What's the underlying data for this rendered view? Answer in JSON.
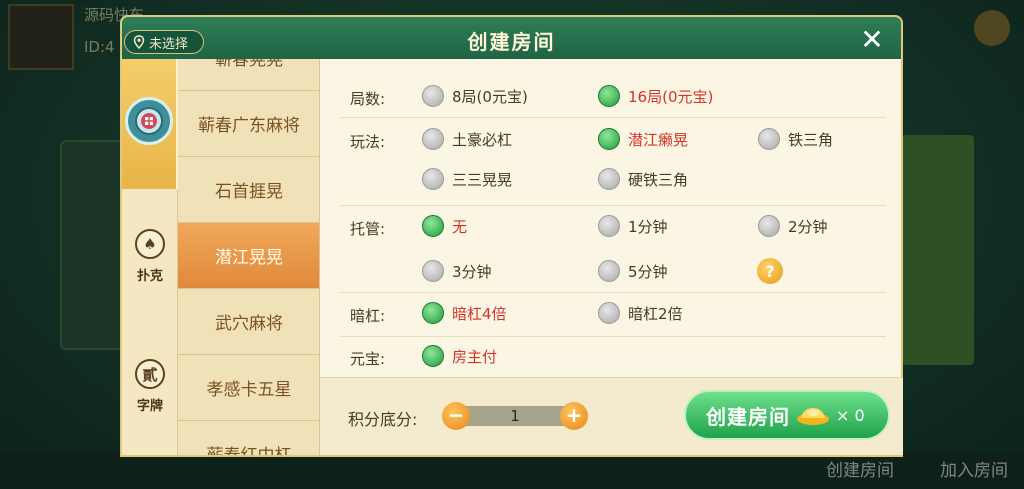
{
  "background": {
    "user_name": "源码快车",
    "user_id": "ID:4",
    "bottom_buttons": [
      "创建房间",
      "加入房间"
    ]
  },
  "dialog": {
    "title": "创建房间",
    "location_pill": "未选择",
    "close_symbol": "✕"
  },
  "category_tabs": [
    {
      "label": "",
      "icon": "mahjong-badge-icon",
      "active": true
    },
    {
      "label": "扑克",
      "icon": "spade-icon",
      "glyph": "♠",
      "active": false
    },
    {
      "label": "字牌",
      "icon": "character-tile-icon",
      "glyph": "貳",
      "active": false
    }
  ],
  "games": [
    {
      "label": "蕲春晃晃",
      "active": false
    },
    {
      "label": "蕲春广东麻将",
      "active": false
    },
    {
      "label": "石首捱晃",
      "active": false
    },
    {
      "label": "潜江晃晃",
      "active": true
    },
    {
      "label": "武穴麻将",
      "active": false
    },
    {
      "label": "孝感卡五星",
      "active": false
    },
    {
      "label": "蕲春红中杠",
      "active": false
    }
  ],
  "options": {
    "rounds": {
      "label": "局数:",
      "choices": [
        {
          "text": "8局(0元宝)",
          "on": false
        },
        {
          "text": "16局(0元宝)",
          "on": true
        }
      ]
    },
    "play": {
      "label": "玩法:",
      "choices": [
        {
          "text": "土豪必杠",
          "on": false
        },
        {
          "text": "潜江癞晃",
          "on": true
        },
        {
          "text": "铁三角",
          "on": false
        },
        {
          "text": "三三晃晃",
          "on": false
        },
        {
          "text": "硬铁三角",
          "on": false
        }
      ]
    },
    "hosting": {
      "label": "托管:",
      "choices": [
        {
          "text": "无",
          "on": true
        },
        {
          "text": "1分钟",
          "on": false
        },
        {
          "text": "2分钟",
          "on": false
        },
        {
          "text": "3分钟",
          "on": false
        },
        {
          "text": "5分钟",
          "on": false
        }
      ],
      "help": "?"
    },
    "angang": {
      "label": "暗杠:",
      "choices": [
        {
          "text": "暗杠4倍",
          "on": true
        },
        {
          "text": "暗杠2倍",
          "on": false
        }
      ]
    },
    "ingot": {
      "label": "元宝:",
      "choices": [
        {
          "text": "房主付",
          "on": true
        }
      ]
    }
  },
  "footer": {
    "score_label": "积分底分:",
    "score_value": "1",
    "minus": "−",
    "plus": "+",
    "create_label": "创建房间",
    "ingot_count": "× 0"
  },
  "colors": {
    "accent_green": "#1fa24a",
    "selected_red": "#d1352a",
    "panel_bg": "#fbf5e3"
  }
}
